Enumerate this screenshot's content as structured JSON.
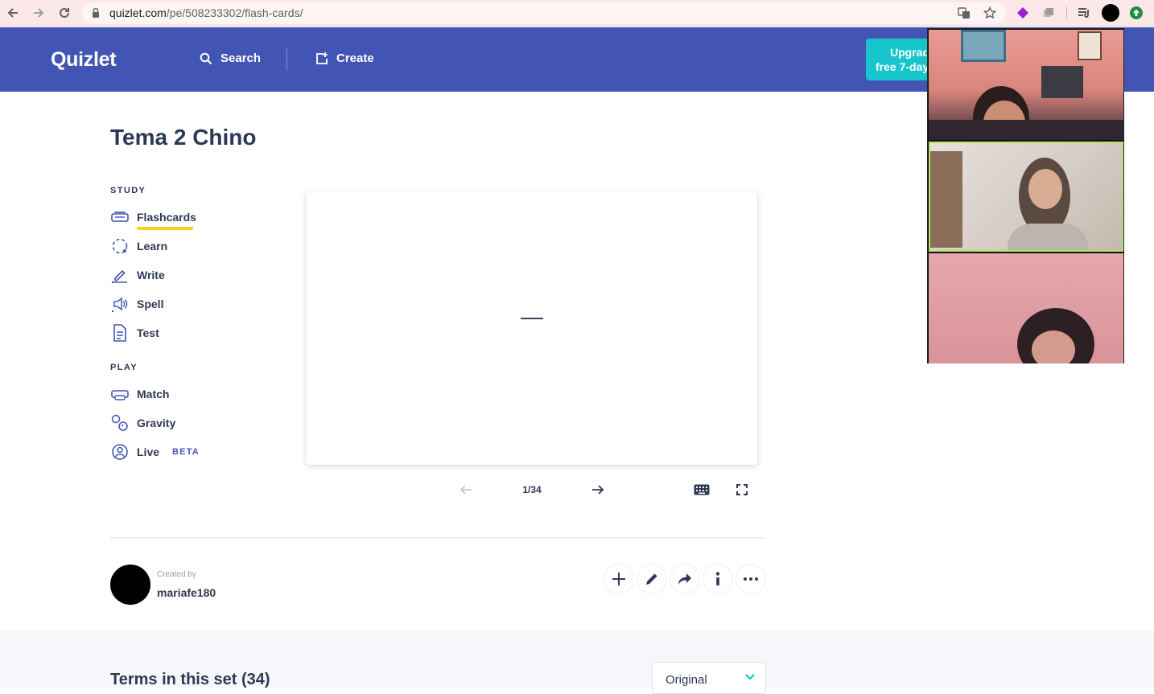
{
  "browser": {
    "url_host": "quizlet.com",
    "url_path": "/pe/508233302/flash-cards/"
  },
  "header": {
    "logo": "Quizlet",
    "search_label": "Search",
    "create_label": "Create",
    "upgrade_line1": "Upgrade:",
    "upgrade_line2": "free 7-day"
  },
  "set": {
    "title": "Tema 2 Chino"
  },
  "study": {
    "label": "STUDY",
    "items": [
      {
        "label": "Flashcards",
        "icon": "flashcards-icon",
        "active": true
      },
      {
        "label": "Learn",
        "icon": "learn-icon"
      },
      {
        "label": "Write",
        "icon": "write-icon"
      },
      {
        "label": "Spell",
        "icon": "spell-icon"
      },
      {
        "label": "Test",
        "icon": "test-icon"
      }
    ]
  },
  "play": {
    "label": "PLAY",
    "items": [
      {
        "label": "Match",
        "icon": "match-icon"
      },
      {
        "label": "Gravity",
        "icon": "gravity-icon"
      },
      {
        "label": "Live",
        "icon": "live-icon",
        "badge": "BETA"
      }
    ]
  },
  "card": {
    "text": "—",
    "counter": "1/34"
  },
  "creator": {
    "created_by_label": "Created by",
    "username": "mariafe180"
  },
  "terms": {
    "title": "Terms in this set (34)",
    "sort_value": "Original"
  },
  "colors": {
    "header_bg": "#4255b5",
    "upgrade_bg": "#16c6cc",
    "active_underline": "#ffcd1f",
    "text": "#2e3856"
  }
}
